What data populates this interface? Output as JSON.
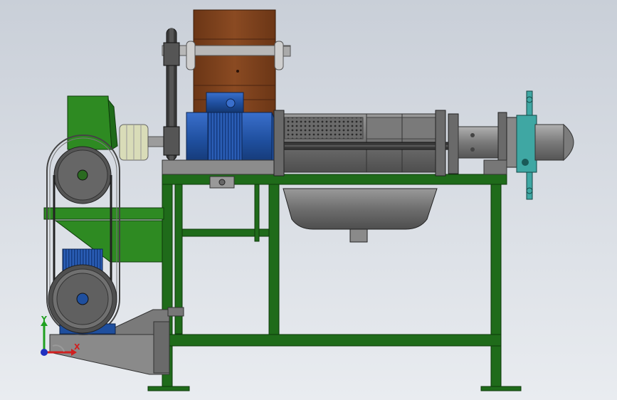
{
  "viewport": {
    "background_top": "#c9cfd8",
    "background_bottom": "#e9ecf0"
  },
  "colors": {
    "frame_green": "#1f6b1a",
    "hopper_green": "#2e8a22",
    "motor_blue": "#1f4f9e",
    "motor_blue_light": "#3a6fcc",
    "hopper_brown": "#8a4a22",
    "steel": "#7c7c7c",
    "steel_light": "#a9a9a9",
    "coupling_teal": "#3fa7a3",
    "shaft_pale": "#d9dcb8",
    "belt_dark": "#2a2a2a",
    "triad_x": "#d02020",
    "triad_y": "#20a020",
    "triad_z": "#2030c0"
  },
  "triad": {
    "x_label": "X",
    "y_label": "Y"
  }
}
